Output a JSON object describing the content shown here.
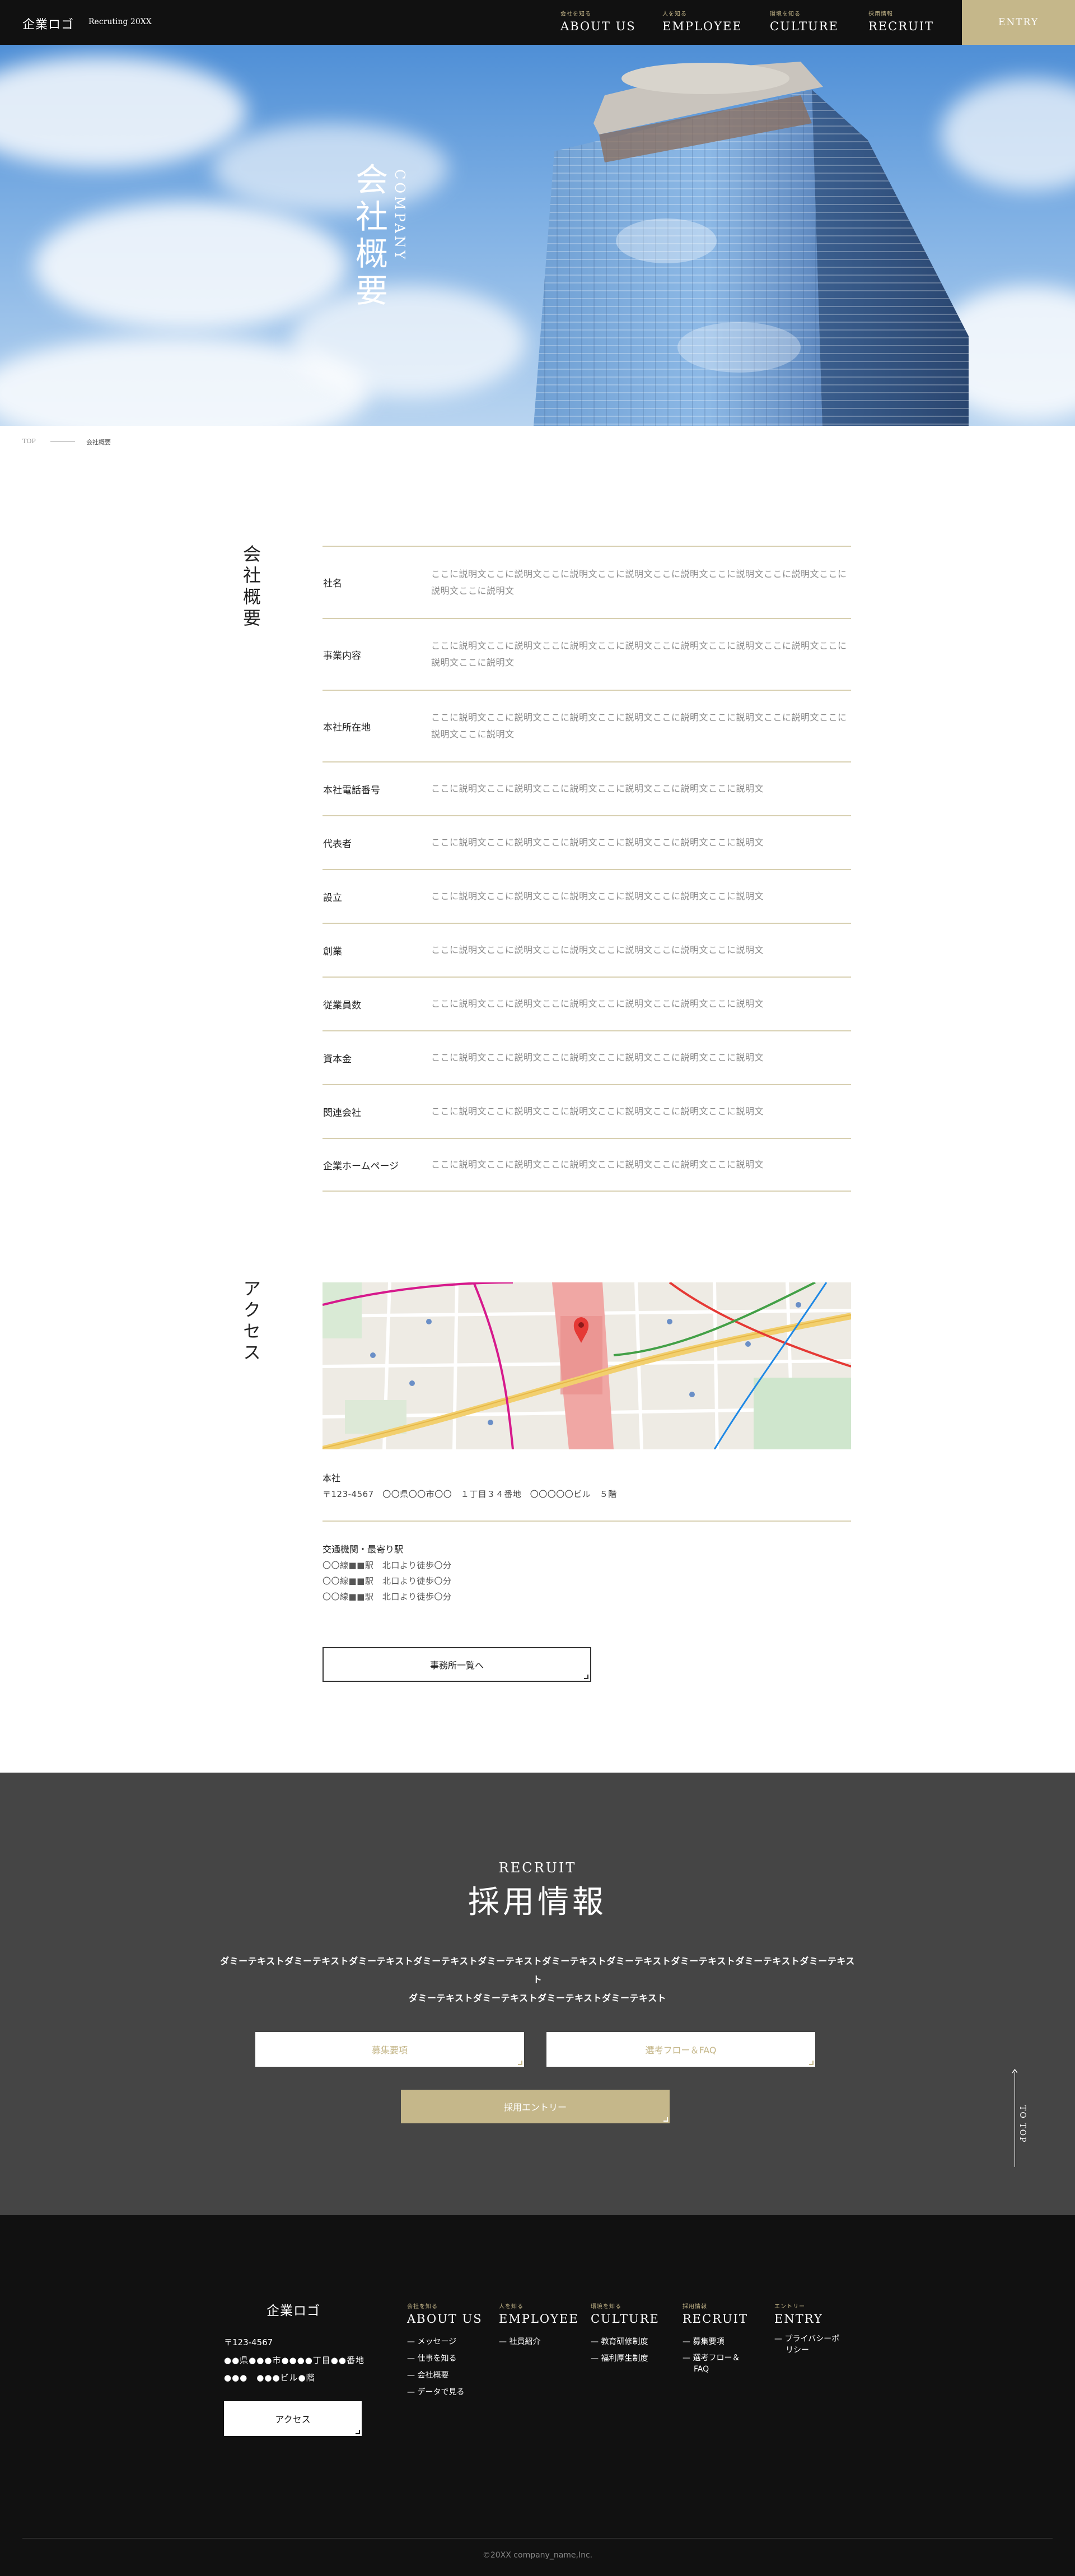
{
  "header": {
    "logo": "企業ロゴ",
    "recruiting": "Recruting 20XX",
    "nav": [
      {
        "sub": "会社を知る",
        "label": "ABOUT US"
      },
      {
        "sub": "人を知る",
        "label": "EMPLOYEE"
      },
      {
        "sub": "環境を知る",
        "label": "CULTURE"
      },
      {
        "sub": "採用情報",
        "label": "RECRUIT"
      }
    ],
    "entry": "ENTRY"
  },
  "hero": {
    "title_jp": "会社概要",
    "title_en": "COMPANY"
  },
  "breadcrumb": {
    "top": "TOP",
    "current": "会社概要"
  },
  "overview": {
    "heading": "会社概要",
    "rows": [
      {
        "label": "社名",
        "value": "ここに説明文ここに説明文ここに説明文ここに説明文ここに説明文ここに説明文ここに説明文ここに説明文ここに説明文"
      },
      {
        "label": "事業内容",
        "value": "ここに説明文ここに説明文ここに説明文ここに説明文ここに説明文ここに説明文ここに説明文ここに説明文ここに説明文"
      },
      {
        "label": "本社所在地",
        "value": "ここに説明文ここに説明文ここに説明文ここに説明文ここに説明文ここに説明文ここに説明文ここに説明文ここに説明文"
      },
      {
        "label": "本社電話番号",
        "value": "ここに説明文ここに説明文ここに説明文ここに説明文ここに説明文ここに説明文"
      },
      {
        "label": "代表者",
        "value": "ここに説明文ここに説明文ここに説明文ここに説明文ここに説明文ここに説明文"
      },
      {
        "label": "設立",
        "value": "ここに説明文ここに説明文ここに説明文ここに説明文ここに説明文ここに説明文"
      },
      {
        "label": "創業",
        "value": "ここに説明文ここに説明文ここに説明文ここに説明文ここに説明文ここに説明文"
      },
      {
        "label": "従業員数",
        "value": "ここに説明文ここに説明文ここに説明文ここに説明文ここに説明文ここに説明文"
      },
      {
        "label": "資本金",
        "value": "ここに説明文ここに説明文ここに説明文ここに説明文ここに説明文ここに説明文"
      },
      {
        "label": "関連会社",
        "value": "ここに説明文ここに説明文ここに説明文ここに説明文ここに説明文ここに説明文"
      },
      {
        "label": "企業ホームページ",
        "value": "ここに説明文ここに説明文ここに説明文ここに説明文ここに説明文ここに説明文"
      }
    ]
  },
  "access": {
    "heading": "アクセス",
    "hq_title": "本社",
    "hq_address": "〒123-4567　〇〇県〇〇市〇〇　１丁目３４番地　〇〇〇〇〇ビル　５階",
    "transit_title": "交通機関・最寄り駅",
    "transit": [
      "〇〇線■■駅　北口より徒歩〇分",
      "〇〇線■■駅　北口より徒歩〇分",
      "〇〇線■■駅　北口より徒歩〇分"
    ],
    "offices_button": "事務所一覧へ"
  },
  "recruit": {
    "title_en": "RECRUIT",
    "title_jp": "採用情報",
    "desc_line1": "ダミーテキストダミーテキストダミーテキストダミーテキストダミーテキストダミーテキストダミーテキストダミーテキストダミーテキストダミーテキスト",
    "desc_line2": "ダミーテキストダミーテキストダミーテキストダミーテキスト",
    "btn_requirements": "募集要項",
    "btn_flow": "選考フロー＆FAQ",
    "btn_entry": "採用エントリー",
    "totop": "TO TOP"
  },
  "footer": {
    "logo": "企業ロゴ",
    "zip": "〒123-4567",
    "address1": "●●県●●●市●●●●丁目●●番地",
    "address2": "●●●　●●●ビル●階",
    "access_button": "アクセス",
    "columns": [
      {
        "sub": "会社を知る",
        "label": "ABOUT US",
        "links": [
          "メッセージ",
          "仕事を知る",
          "会社概要",
          "データで見る"
        ]
      },
      {
        "sub": "人を知る",
        "label": "EMPLOYEE",
        "links": [
          "社員紹介"
        ]
      },
      {
        "sub": "環境を知る",
        "label": "CULTURE",
        "links": [
          "教育研修制度",
          "福利厚生制度"
        ]
      },
      {
        "sub": "採用情報",
        "label": "RECRUIT",
        "links": [
          "募集要項",
          "選考フロー＆FAQ"
        ]
      },
      {
        "sub": "エントリー",
        "label": "ENTRY",
        "links": [
          "プライバシーポリシー"
        ]
      }
    ],
    "copyright": "©20XX company_name,Inc."
  },
  "colors": {
    "gold": "#c5b78a",
    "header_bg": "#111111",
    "recruit_bg": "#454545",
    "footer_bg": "#111111"
  }
}
